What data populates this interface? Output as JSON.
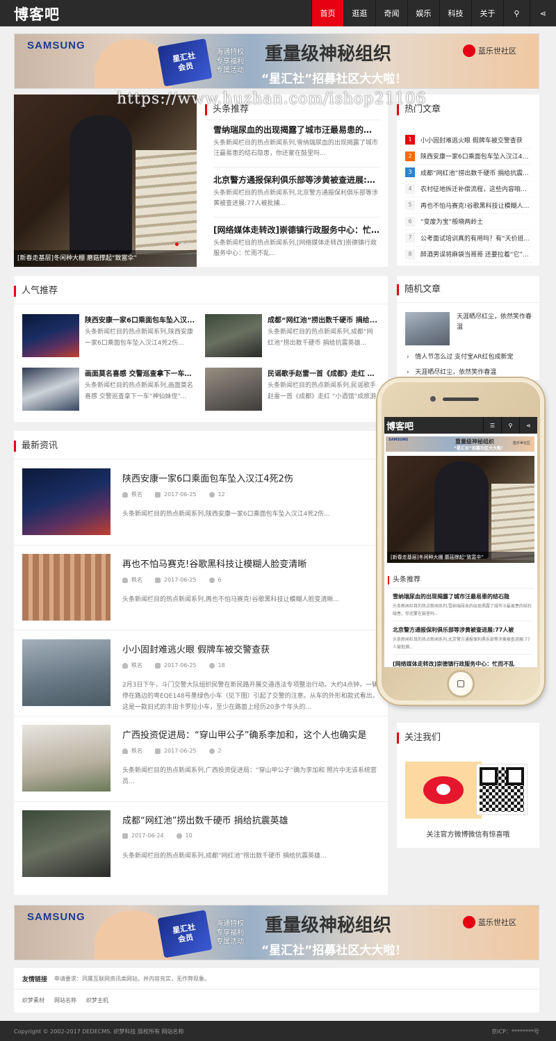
{
  "header": {
    "logo": "博客吧",
    "nav": [
      "首页",
      "逛逛",
      "奇闻",
      "娱乐",
      "科技",
      "关于"
    ],
    "search_icon": "⚲",
    "share_icon": "⋖"
  },
  "banner": {
    "brand": "SAMSUNG",
    "card": "星汇社\n会员",
    "cardtext": "海通特权\n专享福利\n专属活动",
    "title": "重量级神秘组织",
    "subtitle": "“星汇社”招募社区大大啦！",
    "partner": "蓝乐世社区"
  },
  "watermark": "https://www.huzhan.com/ishop21106",
  "slider": {
    "caption": "[新春走基层]冬闲种大棚 蘑菇撑起“致富伞”"
  },
  "headline": {
    "title": "头条推荐",
    "items": [
      {
        "title": "雪纳瑞尿血的出现揭露了城市汪最易患的结石...",
        "desc": "头条新闻栏目的热点新闻系列,雪纳瑞尿血的出现揭露了城市汪最易患的结石隐患，你还蒙在鼓里吗..."
      },
      {
        "title": "北京警方通报保利俱乐部等涉黄被查进展:77...",
        "desc": "头条新闻栏目的热点新闻系列,北京警方通报保利俱乐部等涉黄被查进展:77人被批捕..."
      },
      {
        "title": "[网络媒体走转改]崇德镇行政服务中心：忙而...",
        "desc": "头条新闻栏目的热点新闻系列,[网络媒体走转改]崇德镇行政服务中心：忙而不乱..."
      }
    ]
  },
  "hot": {
    "title": "热门文章",
    "items": [
      "小小固封难逃火眼 假牌车被交警查获",
      "陕西安康一家6口乘面包车坠入汉江4死...",
      "成都“网红池”捞出数千硬币 捐给抗震...",
      "农村征地拆迁补偿流程，这些内容咱们...",
      "再也不怕马赛克!谷歌黑科技让模糊人脸...",
      "“变废为宝”般晓两岭土",
      "公考面试培训真的有用吗？有“天价班...",
      "醉酒男误将麻袋当哥哥 还要拉着“它”..."
    ]
  },
  "popular": {
    "title": "人气推荐",
    "items": [
      {
        "title": "陕西安康一家6口乘面包车坠入汉...",
        "desc": "头条新闻栏目的热点新闻系列,陕西安康一家6口乘面包车坠入汉江4死2伤..."
      },
      {
        "title": "成都“网红池”捞出数千硬币 捐给...",
        "desc": "头条新闻栏目的热点新闻系列,成都“网红池”捞出数千硬币 捐给抗震英雄..."
      },
      {
        "title": "画面莫名喜感 交警巡查拿下一车“...",
        "desc": "头条新闻栏目的热点新闻系列,画面莫名喜感 交警巡查拿下一车“神仙妹侄”..."
      },
      {
        "title": "民谣歌手赵雷一首《成都》走红 “...",
        "desc": "头条新闻栏目的热点新闻系列,民谣歌手赵雷一首《成都》走红 “小酒馆”成旅游地标..."
      }
    ]
  },
  "random": {
    "title": "随机文章",
    "top": "天涯晒尽红尘，依然笑作春温",
    "items": [
      "情人节怎么过 支付宝AR红包成新宠",
      "天涯晒尽红尘，依然笑作春温"
    ]
  },
  "latest": {
    "title": "最新资讯",
    "items": [
      {
        "title": "陕西安康一家6口乘面包车坠入汉江4死2伤",
        "author": "秩名",
        "date": "2017-06-25",
        "views": "12",
        "desc": "头条新闻栏目的热点新闻系列,陕西安康一家6口乘面包车坠入汉江4死2伤..."
      },
      {
        "title": "再也不怕马赛克!谷歌黑科技让模糊人脸变清晰",
        "author": "秩名",
        "date": "2017-06-25",
        "views": "6",
        "desc": "头条新闻栏目的热点新闻系列,再也不怕马赛克!谷歌黑科技让模糊人脸变清晰..."
      },
      {
        "title": "小小固封难逃火眼 假牌车被交警查获",
        "author": "秩名",
        "date": "2017-06-25",
        "views": "18",
        "desc": "2月3日下午，斗门交警大队组织民警在新民路开展交通违法专项整治行动。大约4点钟，一辆停在路边的粤EQE148号墨绿色小车（见下图）引起了交警的注意。从车的外形和款式看出，这是一款旧式的丰田卡罗拉小车，至少在路面上经历20多个年头的..."
      },
      {
        "title": "广西投资促进局：“穿山甲公子”确系李加和，这个人也确实是",
        "author": "秩名",
        "date": "2017-06-25",
        "views": "2",
        "desc": "头条新闻栏目的热点新闻系列,广西投资促进局：“穿山甲公子”确为李加和 照片中无该系统官员..."
      },
      {
        "title": "成都“网红池”捞出数千硬币 捐给抗震英雄",
        "author": "",
        "date": "2017-06-24",
        "views": "10",
        "desc": "头条新闻栏目的热点新闻系列,成都“网红池”捞出数千硬币 捐给抗震英雄..."
      }
    ]
  },
  "follow": {
    "title": "关注我们",
    "text": "关注官方微博微信有惊喜哦"
  },
  "links": {
    "label": "友情链接",
    "note": "申请要求：同属互联网资讯类网站，并内容充实，无作弊现象。",
    "items": [
      "织梦素材",
      "网站名称",
      "织梦主机"
    ]
  },
  "footer": {
    "copyright": "Copyright © 2002-2017 DEDECMS. 织梦科技 版权所有 网站名称",
    "icp": "京ICP：********号"
  },
  "phone": {
    "logo": "博客吧",
    "menu": "☰",
    "banner_brand": "SAMSUNG",
    "banner_title": "重量级神秘组织",
    "banner_sub": "“星汇社”招募社区大大啦！",
    "banner_partner": "蓝乐世社区",
    "caption": "[新春走基层]冬闲种大棚 蘑菇撑起“致富伞”",
    "sec": "头条推荐",
    "items": [
      {
        "title": "雪纳瑞尿血的出现揭露了城市汪最易患的结石隐",
        "desc": "头条新闻栏目的热点新闻系列,雪纳瑞尿血的出现揭露了城市汪最易患的结石隐患，你还蒙在鼓里吗..."
      },
      {
        "title": "北京警方通报保利俱乐部等涉黄被查进展:77人被",
        "desc": "头条新闻栏目的热点新闻系列,北京警方通报保利俱乐部等涉黄被查进展:77人被批捕..."
      },
      {
        "title": "[网络媒体走转改]崇德镇行政服务中心：忙而不乱",
        "desc": ""
      }
    ]
  },
  "colors": {
    "accent": "#e60012",
    "dark": "#2b2b2b",
    "background": "#f0f0f0"
  }
}
